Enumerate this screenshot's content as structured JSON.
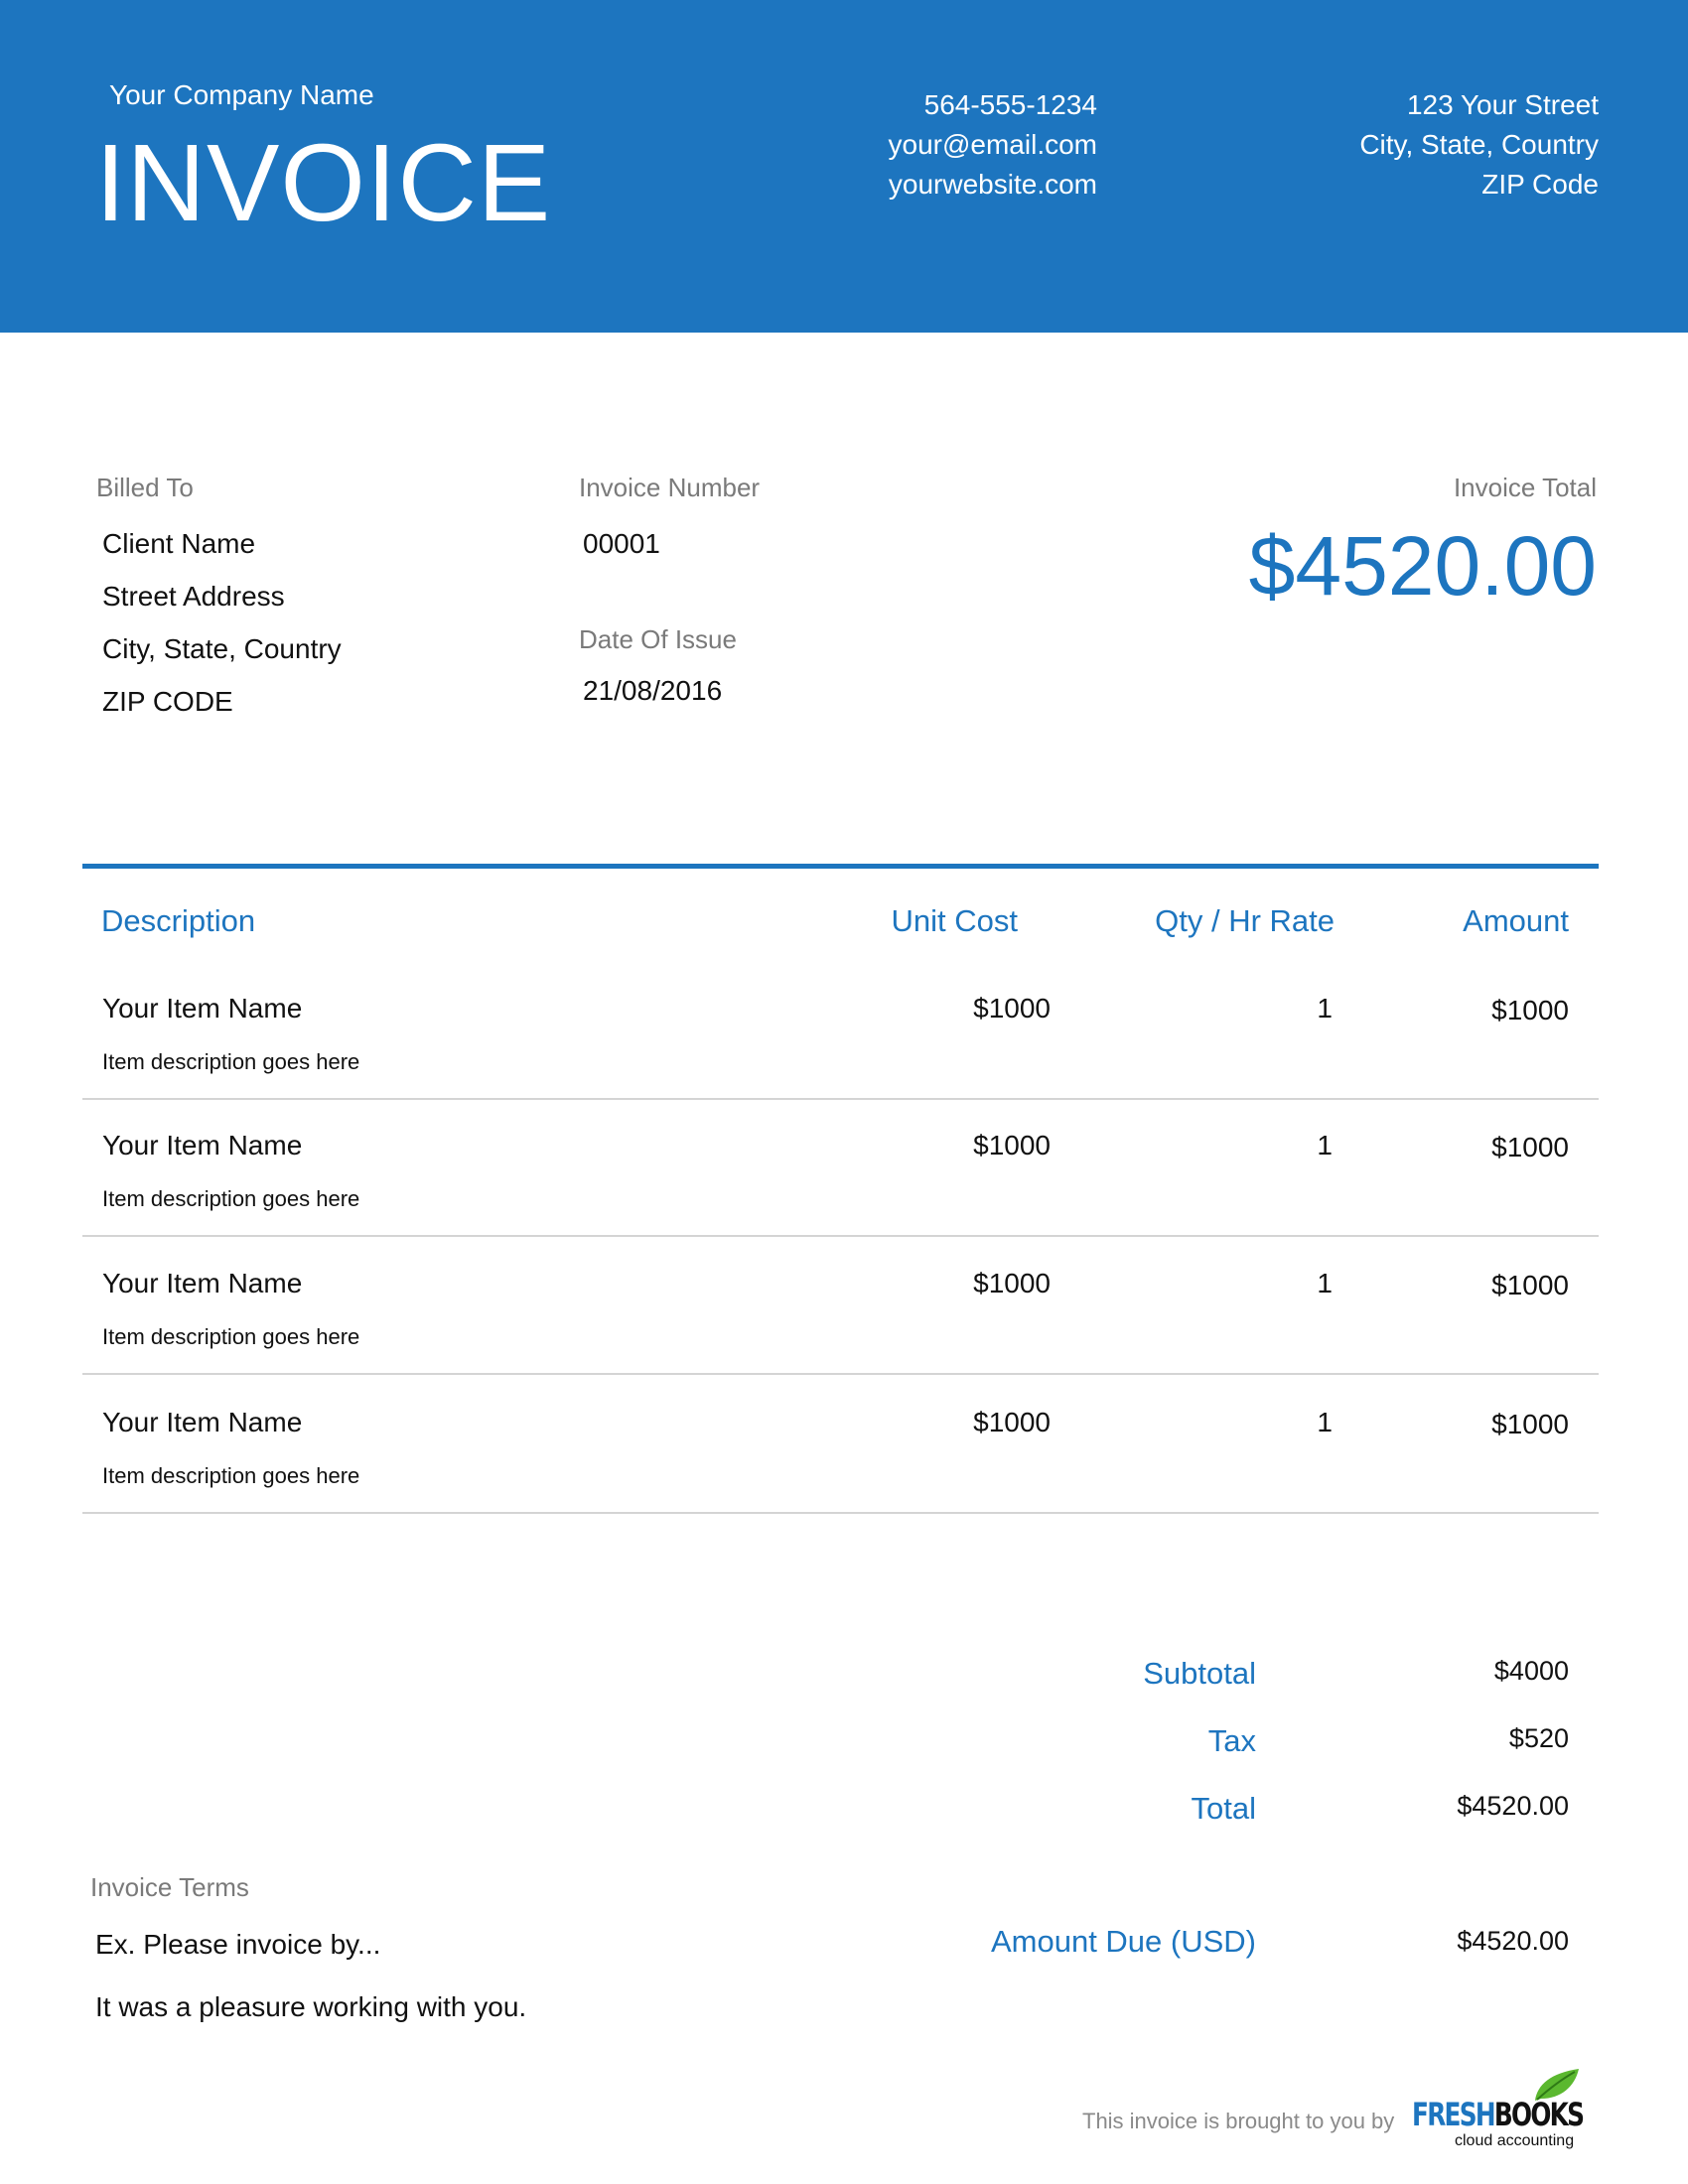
{
  "header": {
    "company_name": "Your Company Name",
    "title": "INVOICE",
    "contact": [
      "564-555-1234",
      "your@email.com",
      "yourwebsite.com"
    ],
    "address": [
      "123 Your Street",
      "City, State, Country",
      "ZIP Code"
    ]
  },
  "billed_to": {
    "label": "Billed To",
    "lines": [
      "Client Name",
      "Street Address",
      "City, State, Country",
      "ZIP CODE"
    ]
  },
  "invoice_number": {
    "label": "Invoice Number",
    "value": "00001"
  },
  "date_of_issue": {
    "label": "Date Of Issue",
    "value": "21/08/2016"
  },
  "invoice_total": {
    "label": "Invoice Total",
    "value": "$4520.00"
  },
  "table": {
    "headers": {
      "description": "Description",
      "unit_cost": "Unit Cost",
      "qty": "Qty / Hr Rate",
      "amount": "Amount"
    },
    "rows": [
      {
        "name": "Your Item Name",
        "description": "Item description goes here",
        "unit_cost": "$1000",
        "qty": "1",
        "amount": "$1000"
      },
      {
        "name": "Your Item Name",
        "description": "Item description goes here",
        "unit_cost": "$1000",
        "qty": "1",
        "amount": "$1000"
      },
      {
        "name": "Your Item Name",
        "description": "Item description goes here",
        "unit_cost": "$1000",
        "qty": "1",
        "amount": "$1000"
      },
      {
        "name": "Your Item Name",
        "description": "Item description goes here",
        "unit_cost": "$1000",
        "qty": "1",
        "amount": "$1000"
      }
    ]
  },
  "summary": {
    "subtotal_label": "Subtotal",
    "subtotal": "$4000",
    "tax_label": "Tax",
    "tax": "$520",
    "total_label": "Total",
    "total": "$4520.00",
    "amount_due_label": "Amount Due (USD)",
    "amount_due": "$4520.00"
  },
  "terms": {
    "label": "Invoice Terms",
    "lines": [
      "Ex. Please invoice by...",
      "It was a pleasure working with you."
    ]
  },
  "footer": {
    "note": "This invoice is brought to you by",
    "logo_fresh": "FRESH",
    "logo_books": "BOOKS",
    "logo_tagline": "cloud accounting"
  },
  "colors": {
    "accent": "#1d75bf",
    "label_gray": "#7a7a7a",
    "divider": "#d4d4d4",
    "leaf": "#5bb82f"
  }
}
